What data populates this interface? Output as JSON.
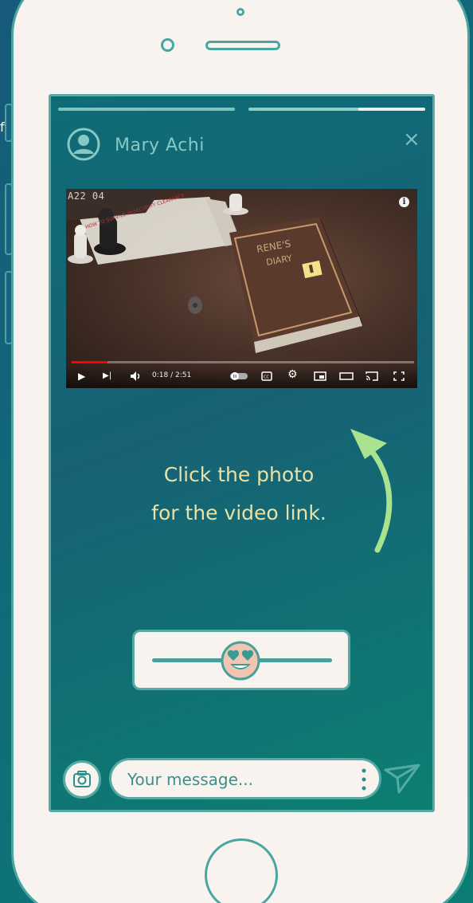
{
  "stray_text": "f",
  "story": {
    "username": "Mary Achi",
    "close_label": "×",
    "progress_segments": [
      {
        "state": "viewed"
      },
      {
        "state": "active",
        "progress": 0.38
      }
    ]
  },
  "video": {
    "corner_code": "A22 04",
    "diary_text_1": "RENE'S",
    "diary_text_2": "DIARY",
    "letter_text": "HOW TO SURVIVE IN SECURITY CLEARANCE",
    "info_label": "i",
    "time_display": "0:18 / 2:51",
    "played_fraction": 0.105,
    "controls": {
      "play": "▶",
      "next": "▶|",
      "volume": "🔊",
      "autoplay": "autoplay-toggle",
      "cc": "CC",
      "settings": "⚙",
      "miniplayer": "miniplayer",
      "theater": "theater",
      "cast": "cast",
      "fullscreen": "fullscreen"
    }
  },
  "instruction": {
    "line1": "Click the photo",
    "line2": "for the video link."
  },
  "reaction_slider": {
    "emoji": "heart-eyes-emoji",
    "value": 0.5
  },
  "composer": {
    "placeholder": "Your message..."
  },
  "colors": {
    "background_start": "#17597a",
    "background_end": "#0b7d72",
    "phone_body": "#f8f3ef",
    "outline": "#4aa5a0",
    "instruction_text": "#e9e2a6",
    "arrow": "#a9e38f",
    "progress_red": "#ff0000"
  }
}
